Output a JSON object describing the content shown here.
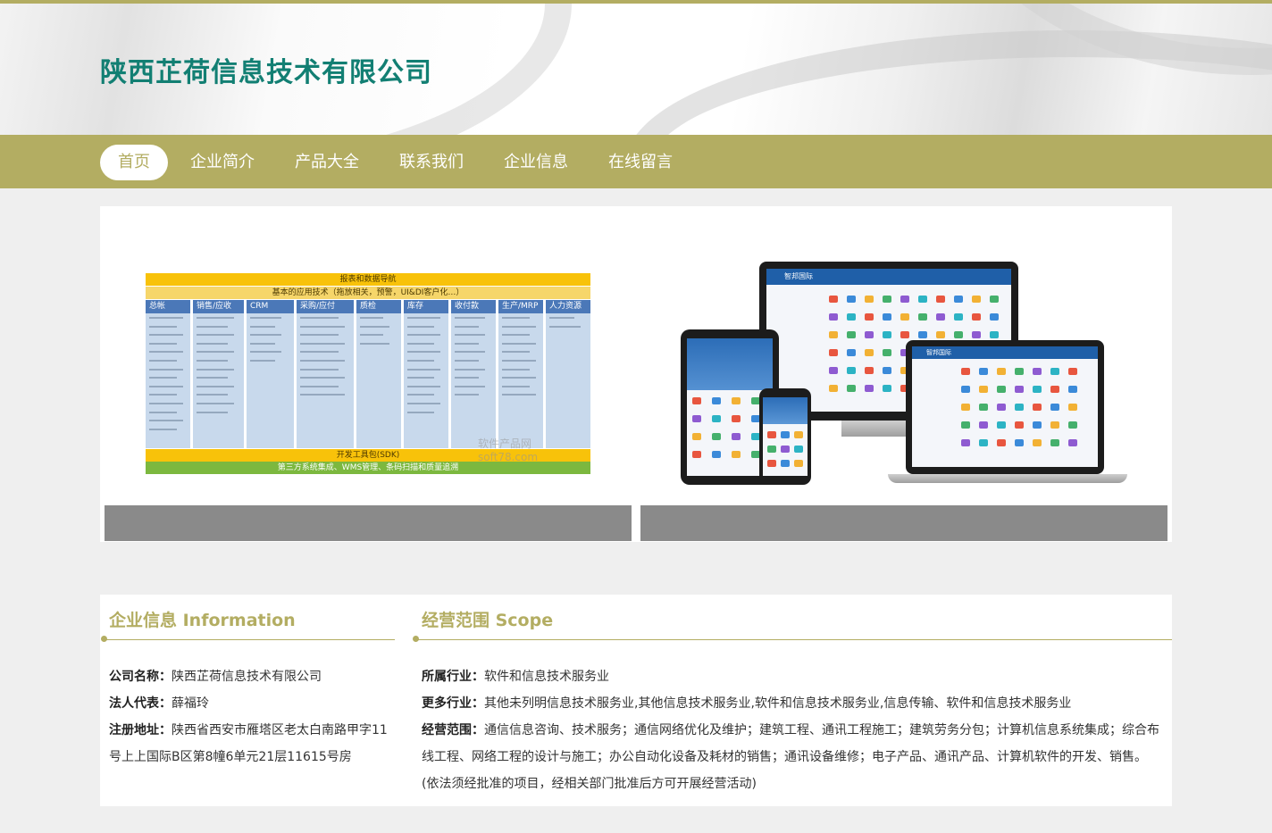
{
  "header": {
    "company_name": "陕西芷荷信息技术有限公司"
  },
  "nav": {
    "items": [
      "首页",
      "企业简介",
      "产品大全",
      "联系我们",
      "企业信息",
      "在线留言"
    ],
    "active_index": 0
  },
  "gallery": {
    "erp": {
      "top_bar": "报表和数据导航",
      "sub_bar": "基本的应用技术（拖放相关，预警，UI&DI客户化…）",
      "columns": [
        "总帐",
        "销售/应收",
        "CRM",
        "采购/应付",
        "质检",
        "库存",
        "收付款",
        "生产/MRP",
        "人力资源"
      ],
      "bottom_bar": "开发工具包(SDK)",
      "footer_bar": "第三方系统集成、WMS管理、条码扫描和质量追溯",
      "watermark": "软件产品网 soft78.com"
    },
    "devices": {
      "brand": "智邦国际"
    }
  },
  "company_info": {
    "title": "企业信息 Information",
    "name_label": "公司名称：",
    "name_value": "陕西芷荷信息技术有限公司",
    "rep_label": "法人代表：",
    "rep_value": "薛福玲",
    "address_label": "注册地址：",
    "address_value": "陕西省西安市雁塔区老太白南路甲字11号上上国际B区第8幢6单元21层11615号房"
  },
  "scope": {
    "title": "经营范围 Scope",
    "industry_label": "所属行业：",
    "industry_value": "软件和信息技术服务业",
    "more_label": "更多行业：",
    "more_value": "其他未列明信息技术服务业,其他信息技术服务业,软件和信息技术服务业,信息传输、软件和信息技术服务业",
    "scope_label": "经营范围：",
    "scope_value": "通信信息咨询、技术服务；通信网络优化及维护；建筑工程、通讯工程施工；建筑劳务分包；计算机信息系统集成；综合布线工程、网络工程的设计与施工；办公自动化设备及耗材的销售；通讯设备维修；电子产品、通讯产品、计算机软件的开发、销售。(依法须经批准的项目，经相关部门批准后方可开展经营活动)"
  },
  "colors": {
    "accent": "#b3ad62",
    "title_green": "#127f73",
    "caption_gray": "#8a8a8a"
  }
}
